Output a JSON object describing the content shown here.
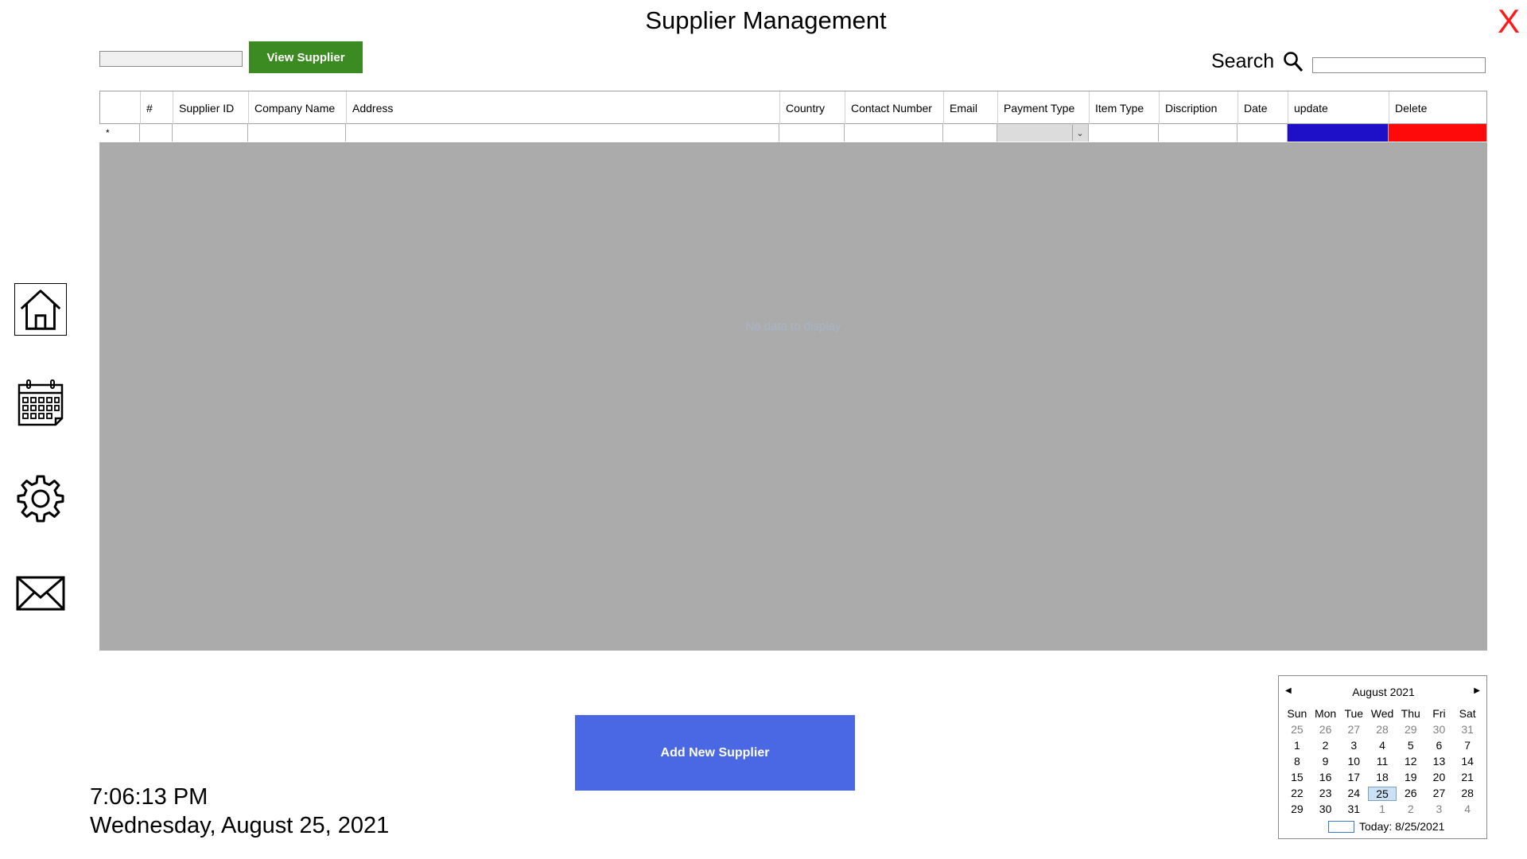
{
  "header": {
    "title": "Supplier Management",
    "close_label": "X"
  },
  "toolbar": {
    "supplier_input_value": "",
    "view_button_label": "View Supplier"
  },
  "search": {
    "label": "Search",
    "value": ""
  },
  "grid": {
    "columns": [
      "#",
      "Supplier ID",
      "Company Name",
      "Address",
      "Country",
      "Contact Number",
      "Email",
      "Payment Type",
      "Item Type",
      "Discription",
      "Date",
      "update",
      "Delete"
    ],
    "new_row_marker": "*",
    "empty_hint": "No data to display",
    "colors": {
      "update_cell": "#1e0fc8",
      "delete_cell": "#ff0a0a",
      "background": "#ababab"
    }
  },
  "actions": {
    "add_label": "Add New Supplier"
  },
  "clock": {
    "time": "7:06:13 PM",
    "date": "Wednesday, August 25, 2021"
  },
  "nav": {
    "items": [
      "home-icon",
      "calendar-icon",
      "settings-icon",
      "mail-icon"
    ]
  },
  "calendar": {
    "title": "August 2021",
    "days": [
      "Sun",
      "Mon",
      "Tue",
      "Wed",
      "Thu",
      "Fri",
      "Sat"
    ],
    "weeks": [
      [
        "25",
        "26",
        "27",
        "28",
        "29",
        "30",
        "31"
      ],
      [
        "1",
        "2",
        "3",
        "4",
        "5",
        "6",
        "7"
      ],
      [
        "8",
        "9",
        "10",
        "11",
        "12",
        "13",
        "14"
      ],
      [
        "15",
        "16",
        "17",
        "18",
        "19",
        "20",
        "21"
      ],
      [
        "22",
        "23",
        "24",
        "25",
        "26",
        "27",
        "28"
      ],
      [
        "29",
        "30",
        "31",
        "1",
        "2",
        "3",
        "4"
      ]
    ],
    "selected": "25",
    "today_label": "Today: 8/25/2021"
  }
}
